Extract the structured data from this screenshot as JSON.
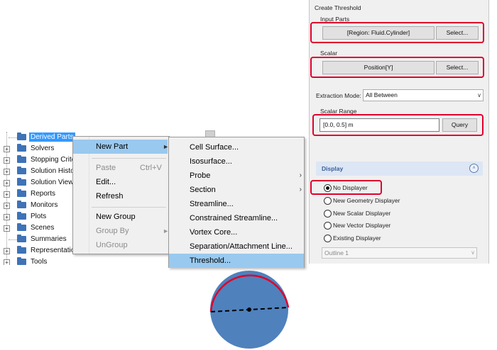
{
  "tree": {
    "items": [
      {
        "label": "Derived Parts",
        "selected": true
      },
      {
        "label": "Solvers"
      },
      {
        "label": "Stopping Crite"
      },
      {
        "label": "Solution Histor"
      },
      {
        "label": "Solution Views"
      },
      {
        "label": "Reports"
      },
      {
        "label": "Monitors"
      },
      {
        "label": "Plots"
      },
      {
        "label": "Scenes"
      },
      {
        "label": "Summaries"
      },
      {
        "label": "Representations"
      },
      {
        "label": "Tools"
      }
    ]
  },
  "context_menu": {
    "items": [
      {
        "label": "New Part"
      },
      {
        "label": "Paste",
        "shortcut": "Ctrl+V"
      },
      {
        "label": "Edit..."
      },
      {
        "label": "Refresh"
      },
      {
        "label": "New Group"
      },
      {
        "label": "Group By"
      },
      {
        "label": "UnGroup"
      }
    ]
  },
  "submenu": {
    "items": [
      {
        "label": "Cell Surface..."
      },
      {
        "label": "Isosurface..."
      },
      {
        "label": "Probe"
      },
      {
        "label": "Section"
      },
      {
        "label": "Streamline..."
      },
      {
        "label": "Constrained Streamline..."
      },
      {
        "label": "Vortex Core..."
      },
      {
        "label": "Separation/Attachment Line..."
      },
      {
        "label": "Threshold..."
      }
    ]
  },
  "panel": {
    "title": "Create Threshold",
    "input_parts_label": "Input Parts",
    "input_parts_value": "[Region: Fluid.Cylinder]",
    "select_label": "Select...",
    "scalar_label": "Scalar",
    "scalar_value": "Position[Y]",
    "extraction_mode_label": "Extraction Mode:",
    "extraction_mode_value": "All Between",
    "scalar_range_label": "Scalar Range",
    "scalar_range_value": "[0.0, 0.5] m",
    "query_label": "Query",
    "display_header": "Display",
    "display_options": [
      {
        "label": "No Displayer",
        "checked": true
      },
      {
        "label": "New Geometry Displayer"
      },
      {
        "label": "New Scalar Displayer"
      },
      {
        "label": "New Vector Displayer"
      },
      {
        "label": "Existing Displayer"
      }
    ],
    "existing_displayer_value": "Outline 1"
  },
  "colors": {
    "highlight_red": "#e0002a",
    "circle_fill": "#4f81bd",
    "menu_highlight": "#99c9ef",
    "tree_selection": "#3399ff"
  }
}
